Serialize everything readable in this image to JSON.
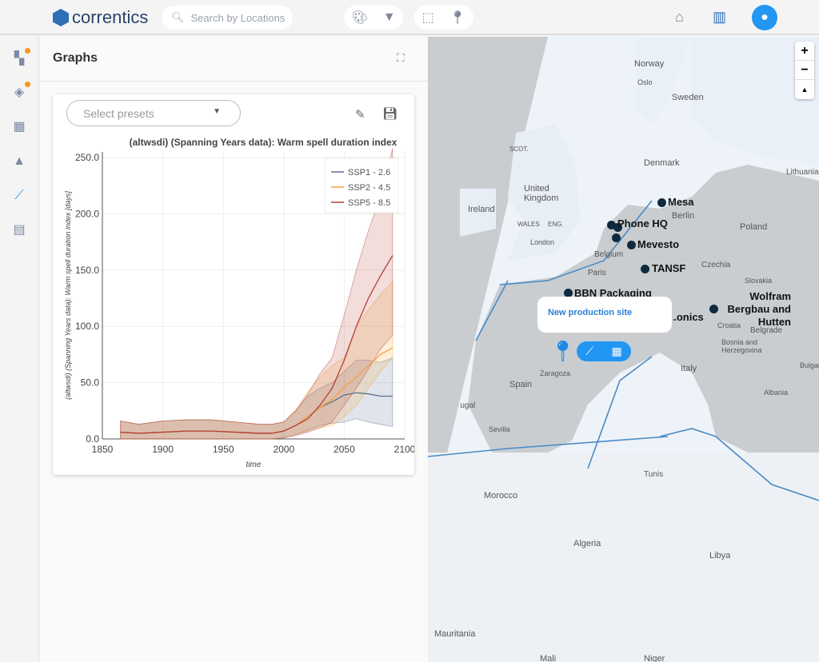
{
  "header": {
    "brand": "correntics",
    "search_placeholder": "Search by Locations"
  },
  "panel": {
    "title": "Graphs",
    "preset_placeholder": "Select presets"
  },
  "chart_data": {
    "type": "line",
    "title": "(altwsdi) (Spanning Years data): Warm spell duration index",
    "xlabel": "time",
    "ylabel": "(altwsdi) (Spanning Years data): Warm spell duration index [days]",
    "xlim": [
      1850,
      2100
    ],
    "ylim": [
      0,
      255
    ],
    "xticks": [
      1850,
      1900,
      1950,
      2000,
      2050,
      2100
    ],
    "yticks": [
      "0.0",
      "50.0",
      "100.0",
      "150.0",
      "200.0",
      "250.0"
    ],
    "grid": true,
    "legend_position": "top-right",
    "x": [
      1865,
      1880,
      1900,
      1920,
      1940,
      1960,
      1980,
      1990,
      2000,
      2010,
      2020,
      2030,
      2040,
      2050,
      2060,
      2070,
      2080,
      2090
    ],
    "series": [
      {
        "name": "SSP1 - 2.6",
        "color": "#5b6f8f",
        "values": [
          6,
          5,
          6,
          7,
          7,
          6,
          5,
          5,
          7,
          12,
          20,
          28,
          33,
          39,
          41,
          40,
          38,
          38
        ],
        "lower": [
          0,
          0,
          0,
          0,
          0,
          0,
          0,
          0,
          1,
          4,
          8,
          12,
          14,
          15,
          18,
          15,
          13,
          11
        ],
        "upper": [
          16,
          13,
          16,
          17,
          17,
          15,
          13,
          13,
          15,
          25,
          38,
          45,
          50,
          60,
          70,
          70,
          68,
          72
        ]
      },
      {
        "name": "SSP2 - 4.5",
        "color": "#f2a43a",
        "values": [
          6,
          5,
          6,
          7,
          7,
          6,
          5,
          5,
          7,
          12,
          20,
          28,
          35,
          46,
          55,
          65,
          75,
          81
        ],
        "lower": [
          0,
          0,
          0,
          0,
          0,
          0,
          0,
          0,
          1,
          4,
          7,
          10,
          12,
          20,
          30,
          45,
          60,
          72
        ],
        "upper": [
          16,
          13,
          16,
          17,
          17,
          15,
          13,
          13,
          15,
          26,
          42,
          55,
          65,
          72,
          100,
          115,
          128,
          140
        ]
      },
      {
        "name": "SSP5 - 8.5",
        "color": "#b5403a",
        "values": [
          6,
          5,
          6,
          7,
          7,
          6,
          5,
          5,
          7,
          12,
          18,
          30,
          45,
          70,
          100,
          125,
          145,
          163
        ],
        "lower": [
          0,
          0,
          0,
          0,
          0,
          0,
          0,
          0,
          1,
          3,
          6,
          10,
          15,
          30,
          45,
          62,
          80,
          92
        ],
        "upper": [
          16,
          13,
          16,
          17,
          17,
          15,
          13,
          13,
          15,
          25,
          40,
          58,
          72,
          110,
          150,
          185,
          215,
          258
        ]
      }
    ]
  },
  "map": {
    "zoom_in": "+",
    "zoom_out": "−",
    "reset_north": "▲",
    "countries": [
      "Norway",
      "Oslo",
      "Sweden",
      "Denmark",
      "United Kingdom",
      "Ireland",
      "London",
      "SCOT.",
      "ENG.",
      "WALES",
      "Berlin",
      "Poland",
      "Lithuania",
      "Belgium",
      "Paris",
      "Czechia",
      "Slovakia",
      "Croatia",
      "Belgrade",
      "Bosnia and Herzegovina",
      "Italy",
      "Spain",
      "Zaragoza",
      "Portugal",
      "Sevilla",
      "Morocco",
      "Algeria",
      "Libya",
      "Tunis",
      "Mauritania",
      "Mali",
      "Niger",
      "Bulgaria",
      "Albania"
    ],
    "sites": [
      "Mesa",
      "Phone HQ",
      "Mevesto",
      "TANSF",
      "BBN Packaging",
      "Wolfram Bergbau and Hutten",
      "...onics"
    ],
    "popup_title": "New production site"
  }
}
